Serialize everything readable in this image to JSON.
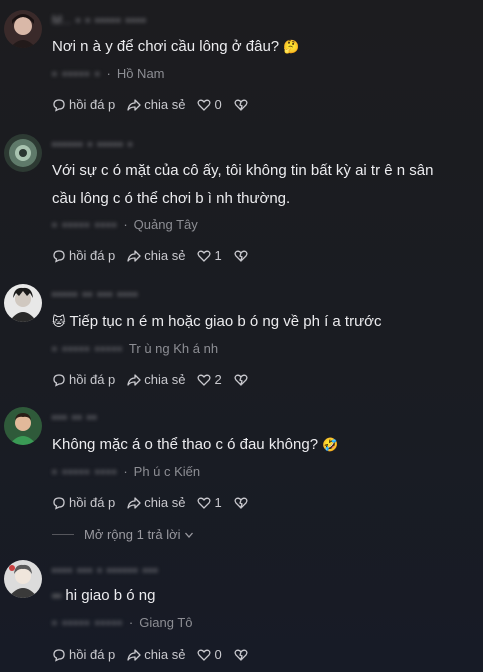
{
  "comments": [
    {
      "username": "M..  ▪ ▪ ▪▪▪▪▪ ▪▪▪▪",
      "text": "Nơi n à y để chơi cầu lông ở đâu?",
      "emoji": "🤔",
      "text2": "",
      "meta_blur": "▪  ▪▪▪▪▪  ▪",
      "location": "Hồ Nam",
      "reply_label": "hồi đá p",
      "share_label": "chia sẻ",
      "likes": "0"
    },
    {
      "username": "▪▪▪▪▪▪ ▪ ▪▪▪▪▪ ▪",
      "text": "Với sự c ó  mặt của cô ấy, tôi không tin bất kỳ ai tr ê n sân",
      "emoji": "",
      "text2": "cầu lông c ó  thể chơi b ì nh thường.",
      "meta_blur": "▪ ▪▪▪▪▪  ▪▪▪▪",
      "location": "Quảng Tây",
      "reply_label": "hồi đá p",
      "share_label": "chia sẻ",
      "likes": "1"
    },
    {
      "username": "▪▪▪▪▪ ▪▪ ▪▪▪ ▪▪▪▪",
      "text": "Tiếp tục n é m hoặc giao b ó ng về ph í a trước",
      "emoji": "🐱",
      "text2": "",
      "meta_blur": "▪ ▪▪▪▪▪  ▪▪▪▪▪",
      "location": "Tr ù ng Kh á nh",
      "reply_label": "hồi đá p",
      "share_label": "chia sẻ",
      "likes": "2"
    },
    {
      "username": "▪▪▪ ▪▪ ▪▪",
      "text": "Không mặc  á o thể thao c ó  đau không?",
      "emoji": "🤣",
      "text2": "",
      "meta_blur": "▪ ▪▪▪▪▪  ▪▪▪▪",
      "location": "Ph ú c Kiến",
      "reply_label": "hồi đá p",
      "share_label": "chia sẻ",
      "likes": "1"
    },
    {
      "username": "▪▪▪▪ ▪▪▪ ▪ ▪▪▪▪▪▪ ▪▪▪",
      "text": "hi giao b ó ng",
      "emoji": "▪▪",
      "text2": "",
      "meta_blur": "▪ ▪▪▪▪▪  ▪▪▪▪▪",
      "location": "Giang Tô",
      "reply_label": "hồi đá p",
      "share_label": "chia sẻ",
      "likes": "0"
    }
  ],
  "expand_replies": "Mở rộng 1 trả lời",
  "colors": {
    "background_top": "#1c1c1f",
    "background_bottom": "#171b26",
    "text": "#ececef",
    "muted": "#8d8e94"
  }
}
